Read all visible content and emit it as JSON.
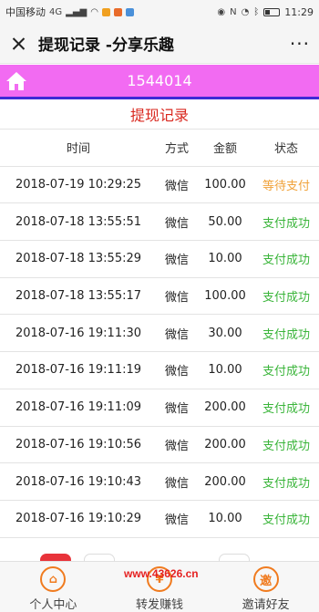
{
  "statusbar": {
    "carrier": "中国移动",
    "network": "4G",
    "time": "11:29"
  },
  "titlebar": {
    "title": "提现记录 -分享乐趣",
    "more": "···"
  },
  "header": {
    "user_id": "1544014"
  },
  "section_title": "提现记录",
  "table": {
    "columns": [
      "时间",
      "方式",
      "金额",
      "状态"
    ],
    "rows": [
      {
        "time": "2018-07-19 10:29:25",
        "method": "微信",
        "amount": "100.00",
        "status": "等待支付",
        "kind": "wait"
      },
      {
        "time": "2018-07-18 13:55:51",
        "method": "微信",
        "amount": "50.00",
        "status": "支付成功",
        "kind": "ok"
      },
      {
        "time": "2018-07-18 13:55:29",
        "method": "微信",
        "amount": "10.00",
        "status": "支付成功",
        "kind": "ok"
      },
      {
        "time": "2018-07-18 13:55:17",
        "method": "微信",
        "amount": "100.00",
        "status": "支付成功",
        "kind": "ok"
      },
      {
        "time": "2018-07-16 19:11:30",
        "method": "微信",
        "amount": "30.00",
        "status": "支付成功",
        "kind": "ok"
      },
      {
        "time": "2018-07-16 19:11:19",
        "method": "微信",
        "amount": "10.00",
        "status": "支付成功",
        "kind": "ok"
      },
      {
        "time": "2018-07-16 19:11:09",
        "method": "微信",
        "amount": "200.00",
        "status": "支付成功",
        "kind": "ok"
      },
      {
        "time": "2018-07-16 19:10:56",
        "method": "微信",
        "amount": "200.00",
        "status": "支付成功",
        "kind": "ok"
      },
      {
        "time": "2018-07-16 19:10:43",
        "method": "微信",
        "amount": "200.00",
        "status": "支付成功",
        "kind": "ok"
      },
      {
        "time": "2018-07-16 19:10:29",
        "method": "微信",
        "amount": "10.00",
        "status": "支付成功",
        "kind": "ok"
      }
    ]
  },
  "watermark": "www.43626.cn",
  "bottom_nav": [
    {
      "label": "个人中心",
      "icon": "home-icon",
      "glyph": "⌂"
    },
    {
      "label": "转发赚钱",
      "icon": "yen-icon",
      "glyph": "¥"
    },
    {
      "label": "邀请好友",
      "icon": "invite-icon",
      "glyph": "邀"
    }
  ],
  "colors": {
    "header_pink": "#f26bf2",
    "header_underline": "#3f2bd6",
    "section_title": "#d9281f",
    "status_wait": "#f0a23a",
    "status_ok": "#3bb53b",
    "nav_accent": "#f07b1f"
  }
}
